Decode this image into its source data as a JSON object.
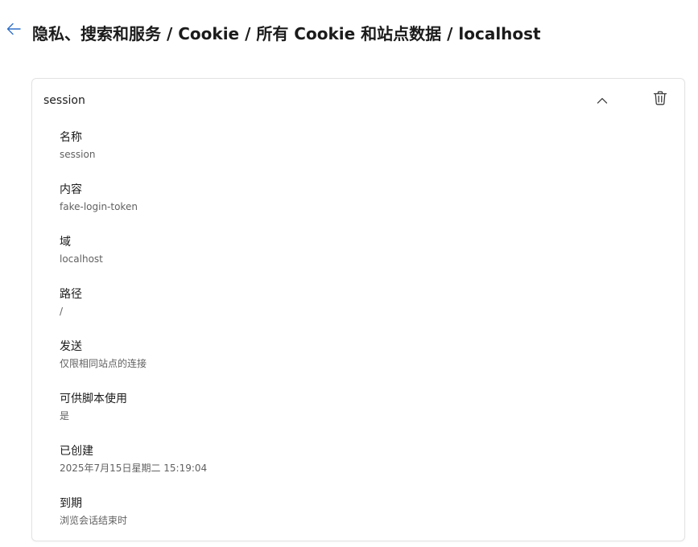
{
  "header": {
    "back_icon": "arrow-left-icon",
    "breadcrumb": "隐私、搜索和服务 / Cookie / 所有 Cookie 和站点数据 / localhost",
    "accent_color": "#2f6fc9"
  },
  "cookie": {
    "name": "session",
    "collapse_icon": "chevron-up-icon",
    "delete_icon": "trash-icon",
    "fields": [
      {
        "label": "名称",
        "value": "session"
      },
      {
        "label": "内容",
        "value": "fake-login-token"
      },
      {
        "label": "域",
        "value": "localhost"
      },
      {
        "label": "路径",
        "value": "/"
      },
      {
        "label": "发送",
        "value": "仅限相同站点的连接"
      },
      {
        "label": "可供脚本使用",
        "value": "是"
      },
      {
        "label": "已创建",
        "value": "2025年7月15日星期二 15:19:04"
      },
      {
        "label": "到期",
        "value": "浏览会话结束时"
      }
    ]
  }
}
